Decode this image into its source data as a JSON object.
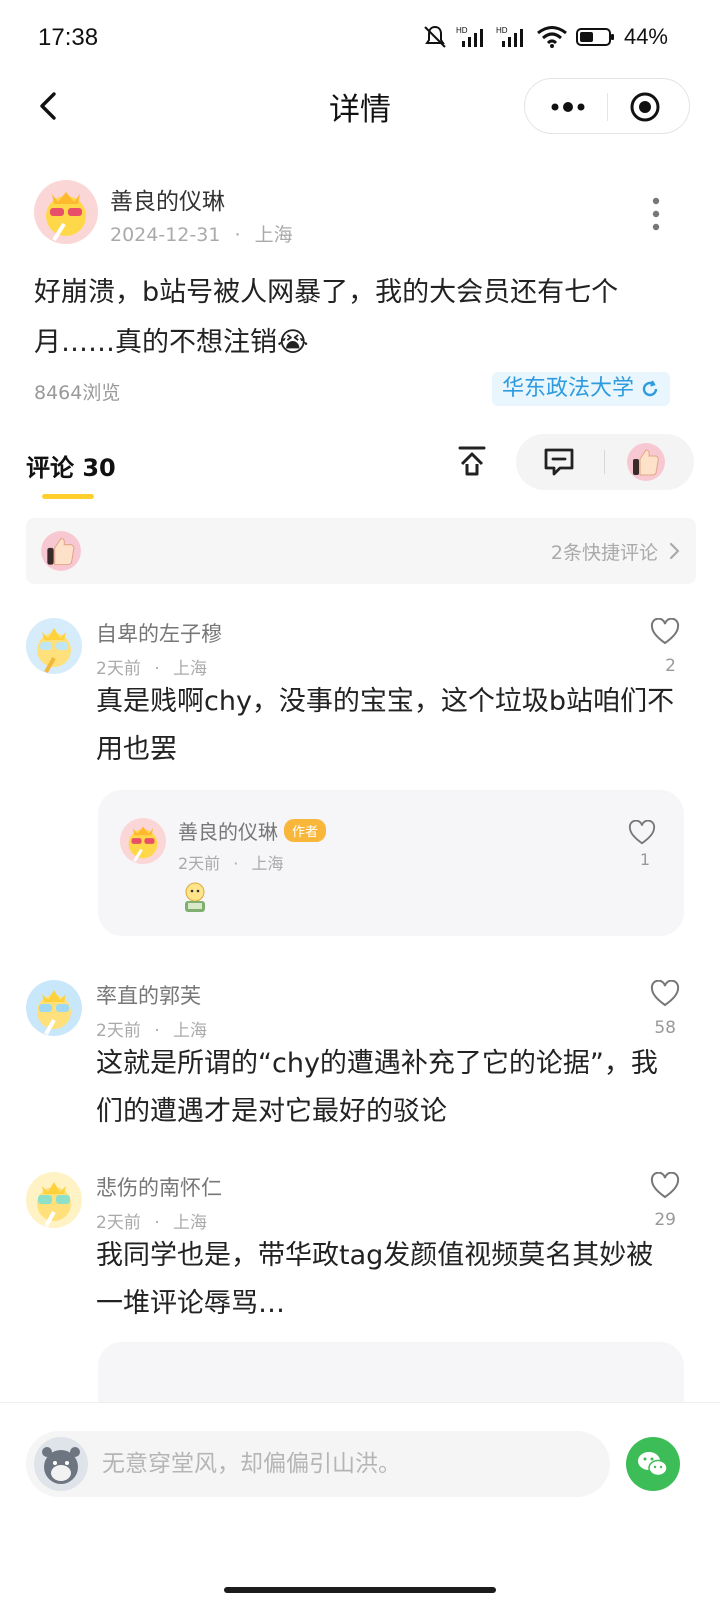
{
  "status_bar": {
    "time": "17:38",
    "battery_percent": "44%",
    "icons": [
      "mute-icon",
      "signal-icon",
      "signal-icon",
      "wifi-icon",
      "battery-icon"
    ]
  },
  "nav": {
    "title": "详情",
    "back_icon": "back-arrow-icon",
    "more_icon": "more-dots-icon",
    "close_icon": "target-close-icon"
  },
  "post": {
    "author": "善良的仪琳",
    "date": "2024-12-31",
    "location": "上海",
    "meta_separator": "·",
    "body": "好崩溃，b站号被人网暴了，我的大会员还有七个月……真的不想注销😭",
    "views": "8464浏览",
    "tag": "华东政法大学"
  },
  "comments_header": {
    "title": "评论 30",
    "share_icon": "share-up-icon",
    "comment_icon": "comment-bubble-icon",
    "thumb_icon": "thumbs-up-icon"
  },
  "quick_comments": {
    "label": "2条快捷评论"
  },
  "comments": [
    {
      "author": "自卑的左子穆",
      "time": "2天前",
      "location": "上海",
      "likes": "2",
      "body": "真是贱啊chy，没事的宝宝，这个垃圾b站咱们不用也罢",
      "reply": {
        "author": "善良的仪琳",
        "badge": "作者",
        "time": "2天前",
        "location": "上海",
        "likes": "1"
      }
    },
    {
      "author": "率直的郭芙",
      "time": "2天前",
      "location": "上海",
      "likes": "58",
      "body": "这就是所谓的“chy的遭遇补充了它的论据”，我们的遭遇才是对它最好的驳论"
    },
    {
      "author": "悲伤的南怀仁",
      "time": "2天前",
      "location": "上海",
      "likes": "29",
      "body": "我同学也是，带华政tag发颜值视频莫名其妙被一堆评论辱骂…"
    }
  ],
  "input": {
    "placeholder": "无意穿堂风，却偏偏引山洪。"
  },
  "colors": {
    "accent_yellow": "#ffcf2e",
    "tag_blue": "#2d9bde",
    "wechat_green": "#3dbd58",
    "author_badge": "#f8b63a"
  }
}
